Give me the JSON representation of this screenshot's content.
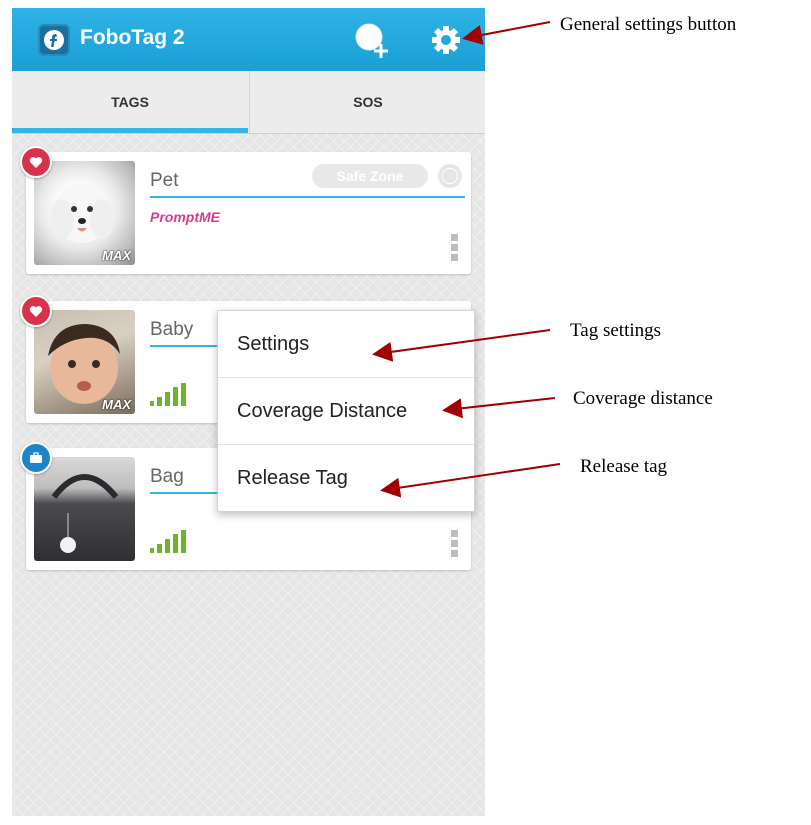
{
  "app": {
    "title": "FoboTag 2"
  },
  "header": {
    "add_tag_icon": "add-tag-icon",
    "settings_icon": "gear-icon"
  },
  "tabs": [
    {
      "label": "TAGS",
      "selected": true
    },
    {
      "label": "SOS",
      "selected": false
    }
  ],
  "tags": [
    {
      "name": "Pet",
      "photo_label": "MAX",
      "badge_icon": "heart-icon",
      "status_pill": "Safe Zone",
      "subtitle": "PromptME"
    },
    {
      "name": "Baby",
      "photo_label": "MAX",
      "badge_icon": "heart-icon",
      "signal_icon": "signal-strength-icon"
    },
    {
      "name": "Bag",
      "photo_label": "",
      "badge_icon": "briefcase-icon",
      "signal_icon": "signal-strength-icon"
    }
  ],
  "popup_menu": {
    "items": [
      {
        "label": "Settings"
      },
      {
        "label": "Coverage Distance"
      },
      {
        "label": "Release Tag"
      }
    ]
  },
  "annotations": {
    "general_settings": "General settings button",
    "tag_settings": "Tag settings",
    "coverage_distance": "Coverage distance",
    "release_tag": "Release tag"
  },
  "colors": {
    "action_bar": "#1fa8dd",
    "tab_indicator": "#33b5e5",
    "heart_badge": "#d9334c",
    "bag_badge": "#1c84c7",
    "subtitle_text": "#d63b91",
    "signal_bars": "#6cb52d",
    "annotation_arrow": "#a00000"
  }
}
